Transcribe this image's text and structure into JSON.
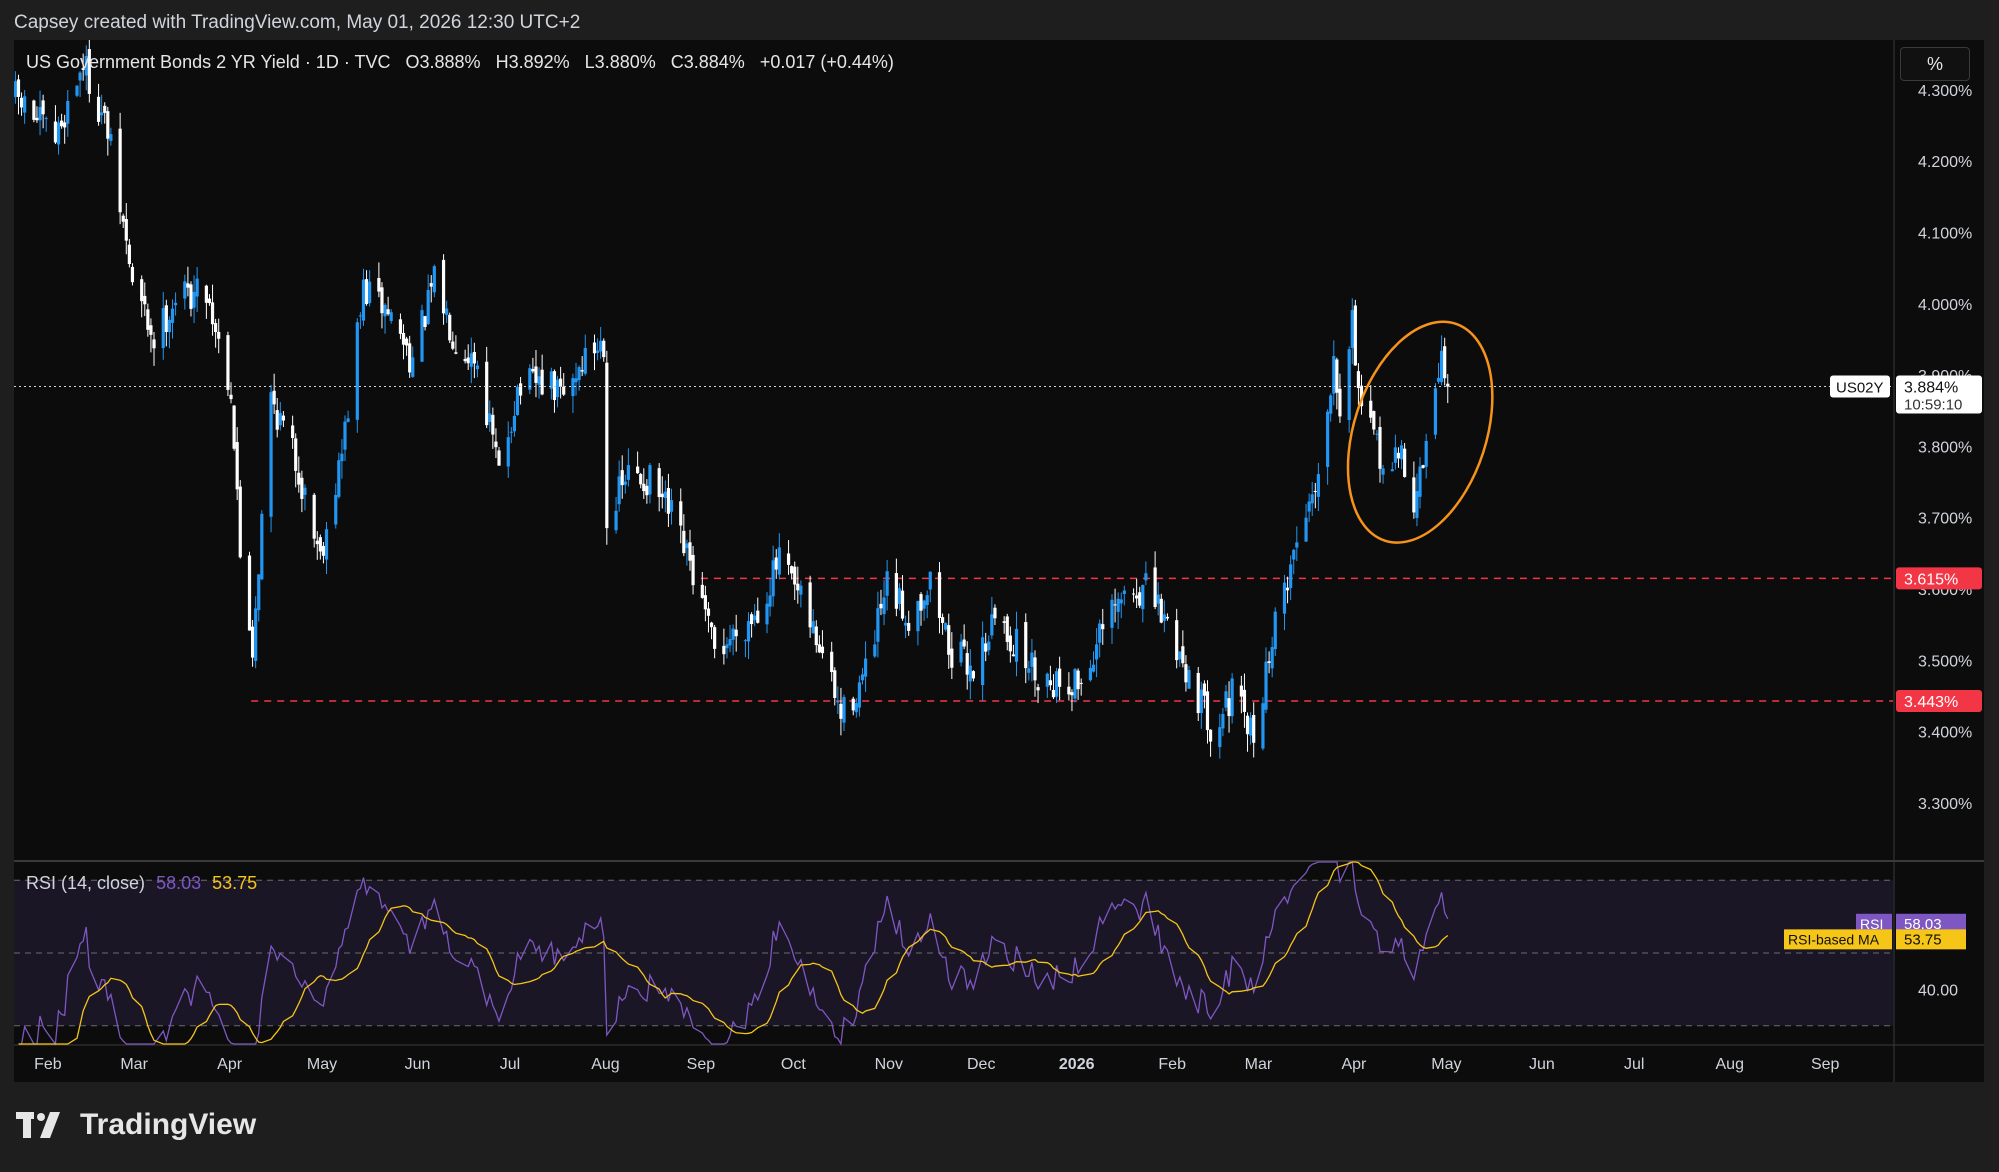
{
  "header": {
    "credit": "Capsey created with TradingView.com, May 01, 2026 12:30 UTC+2"
  },
  "legend": {
    "symbol": "US Government Bonds 2 YR Yield · 1D · TVC",
    "open": "O3.888%",
    "high": "H3.892%",
    "low": "L3.880%",
    "close": "C3.884%",
    "change": "+0.017 (+0.44%)"
  },
  "unit_button": "%",
  "rsi_legend": {
    "label": "RSI (14, close)",
    "rsi_value": "58.03",
    "ma_value": "53.75"
  },
  "brand": "TradingView",
  "colors": {
    "up": "#2196f3",
    "down": "#ffffff",
    "support": "#f23645",
    "highlight_ellipse": "#f7931a",
    "rsi_line": "#7e57c2",
    "rsi_ma": "#f5c518",
    "background": "#0c0c0c"
  },
  "chart_data": {
    "type": "candlestick",
    "title": "US Government Bonds 2 YR Yield · 1D · TVC",
    "symbol_tag": "US02Y",
    "last_price": "3.884%",
    "countdown": "10:59:10",
    "y_ticks": [
      "4.300%",
      "4.200%",
      "4.100%",
      "4.000%",
      "3.900%",
      "3.800%",
      "3.700%",
      "3.600%",
      "3.500%",
      "3.400%",
      "3.300%"
    ],
    "y_tick_values": [
      4.3,
      4.2,
      4.1,
      4.0,
      3.9,
      3.8,
      3.7,
      3.6,
      3.5,
      3.4,
      3.3
    ],
    "x_ticks": [
      "Feb",
      "Mar",
      "Apr",
      "May",
      "Jun",
      "Jul",
      "Aug",
      "Sep",
      "Oct",
      "Nov",
      "Dec",
      "2026",
      "Feb",
      "Mar",
      "Apr",
      "May",
      "Jun",
      "Jul",
      "Aug",
      "Sep"
    ],
    "x_tick_dates": [
      "2025-02-01",
      "2025-03-01",
      "2025-04-01",
      "2025-05-01",
      "2025-06-01",
      "2025-07-01",
      "2025-08-01",
      "2025-09-01",
      "2025-10-01",
      "2025-11-01",
      "2025-12-01",
      "2026-01-01",
      "2026-02-01",
      "2026-03-01",
      "2026-04-01",
      "2026-05-01",
      "2026-06-01",
      "2026-07-01",
      "2026-08-01",
      "2026-09-01"
    ],
    "x_range": [
      "2025-01-21",
      "2026-09-23"
    ],
    "ylim": [
      3.22,
      4.37
    ],
    "support_levels": [
      {
        "label": "3.615%",
        "value": 3.615,
        "from": "2025-09-01"
      },
      {
        "label": "3.443%",
        "value": 3.443,
        "from": "2025-04-08"
      }
    ],
    "price_path": [
      {
        "date": "2025-01-21",
        "value": 4.29
      },
      {
        "date": "2025-02-03",
        "value": 4.23
      },
      {
        "date": "2025-02-12",
        "value": 4.34
      },
      {
        "date": "2025-02-20",
        "value": 4.24
      },
      {
        "date": "2025-02-28",
        "value": 4.03
      },
      {
        "date": "2025-03-07",
        "value": 3.95
      },
      {
        "date": "2025-03-14",
        "value": 4.01
      },
      {
        "date": "2025-03-24",
        "value": 4.02
      },
      {
        "date": "2025-04-01",
        "value": 3.88
      },
      {
        "date": "2025-04-04",
        "value": 3.65
      },
      {
        "date": "2025-04-08",
        "value": 3.52
      },
      {
        "date": "2025-04-14",
        "value": 3.87
      },
      {
        "date": "2025-04-22",
        "value": 3.78
      },
      {
        "date": "2025-04-30",
        "value": 3.65
      },
      {
        "date": "2025-05-07",
        "value": 3.79
      },
      {
        "date": "2025-05-14",
        "value": 4.02
      },
      {
        "date": "2025-05-22",
        "value": 3.99
      },
      {
        "date": "2025-05-30",
        "value": 3.92
      },
      {
        "date": "2025-06-06",
        "value": 4.03
      },
      {
        "date": "2025-06-13",
        "value": 3.95
      },
      {
        "date": "2025-06-20",
        "value": 3.92
      },
      {
        "date": "2025-06-27",
        "value": 3.76
      },
      {
        "date": "2025-07-03",
        "value": 3.88
      },
      {
        "date": "2025-07-11",
        "value": 3.89
      },
      {
        "date": "2025-07-18",
        "value": 3.87
      },
      {
        "date": "2025-07-24",
        "value": 3.92
      },
      {
        "date": "2025-07-31",
        "value": 3.95
      },
      {
        "date": "2025-08-01",
        "value": 3.7
      },
      {
        "date": "2025-08-08",
        "value": 3.76
      },
      {
        "date": "2025-08-15",
        "value": 3.75
      },
      {
        "date": "2025-08-22",
        "value": 3.7
      },
      {
        "date": "2025-08-29",
        "value": 3.62
      },
      {
        "date": "2025-09-05",
        "value": 3.51
      },
      {
        "date": "2025-09-12",
        "value": 3.54
      },
      {
        "date": "2025-09-19",
        "value": 3.57
      },
      {
        "date": "2025-09-26",
        "value": 3.64
      },
      {
        "date": "2025-10-03",
        "value": 3.58
      },
      {
        "date": "2025-10-10",
        "value": 3.51
      },
      {
        "date": "2025-10-16",
        "value": 3.42
      },
      {
        "date": "2025-10-24",
        "value": 3.48
      },
      {
        "date": "2025-10-31",
        "value": 3.6
      },
      {
        "date": "2025-11-07",
        "value": 3.56
      },
      {
        "date": "2025-11-14",
        "value": 3.61
      },
      {
        "date": "2025-11-21",
        "value": 3.51
      },
      {
        "date": "2025-11-28",
        "value": 3.49
      },
      {
        "date": "2025-12-05",
        "value": 3.56
      },
      {
        "date": "2025-12-12",
        "value": 3.52
      },
      {
        "date": "2025-12-19",
        "value": 3.48
      },
      {
        "date": "2025-12-26",
        "value": 3.47
      },
      {
        "date": "2026-01-02",
        "value": 3.47
      },
      {
        "date": "2026-01-09",
        "value": 3.54
      },
      {
        "date": "2026-01-16",
        "value": 3.59
      },
      {
        "date": "2026-01-23",
        "value": 3.6
      },
      {
        "date": "2026-01-30",
        "value": 3.55
      },
      {
        "date": "2026-02-06",
        "value": 3.48
      },
      {
        "date": "2026-02-13",
        "value": 3.41
      },
      {
        "date": "2026-02-20",
        "value": 3.45
      },
      {
        "date": "2026-02-27",
        "value": 3.39
      },
      {
        "date": "2026-03-04",
        "value": 3.51
      },
      {
        "date": "2026-03-10",
        "value": 3.62
      },
      {
        "date": "2026-03-16",
        "value": 3.71
      },
      {
        "date": "2026-03-22",
        "value": 3.8
      },
      {
        "date": "2026-03-25",
        "value": 3.94
      },
      {
        "date": "2026-03-27",
        "value": 3.86
      },
      {
        "date": "2026-03-31",
        "value": 3.98
      },
      {
        "date": "2026-04-03",
        "value": 3.84
      },
      {
        "date": "2026-04-08",
        "value": 3.8
      },
      {
        "date": "2026-04-12",
        "value": 3.76
      },
      {
        "date": "2026-04-16",
        "value": 3.79
      },
      {
        "date": "2026-04-20",
        "value": 3.72
      },
      {
        "date": "2026-04-23",
        "value": 3.78
      },
      {
        "date": "2026-04-26",
        "value": 3.83
      },
      {
        "date": "2026-04-29",
        "value": 3.94
      },
      {
        "date": "2026-05-01",
        "value": 3.884
      }
    ],
    "highlight": {
      "shape": "ellipse",
      "from": "2026-04-01",
      "to": "2026-05-14",
      "top": 3.98,
      "bottom": 3.66
    },
    "rsi": {
      "label": "RSI (14, close)",
      "period": 14,
      "value": 58.03,
      "ma_label": "RSI-based MA",
      "ma_value": 53.75,
      "bands": [
        70,
        50,
        30
      ],
      "y_tick": "40.00",
      "range": [
        25,
        75
      ]
    }
  }
}
